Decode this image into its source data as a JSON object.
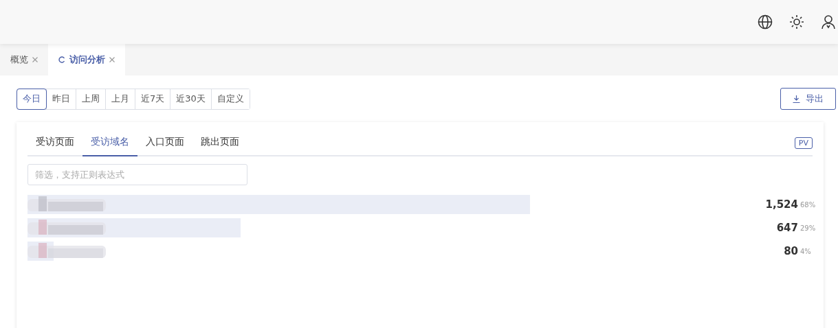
{
  "page_tabs": [
    {
      "label": "概览",
      "selected": false,
      "refresh": false
    },
    {
      "label": "访问分析",
      "selected": true,
      "refresh": true
    }
  ],
  "date_ranges": [
    {
      "label": "今日",
      "selected": true
    },
    {
      "label": "昨日",
      "selected": false
    },
    {
      "label": "上周",
      "selected": false
    },
    {
      "label": "上月",
      "selected": false
    },
    {
      "label": "近7天",
      "selected": false
    },
    {
      "label": "近30天",
      "selected": false
    },
    {
      "label": "自定义",
      "selected": false
    }
  ],
  "export_button": "导出",
  "report_tabs": [
    {
      "label": "受访页面",
      "selected": false
    },
    {
      "label": "受访域名",
      "selected": true
    },
    {
      "label": "入口页面",
      "selected": false
    },
    {
      "label": "跳出页面",
      "selected": false
    }
  ],
  "metric_badge": "PV",
  "filter": {
    "placeholder": "筛选，支持正则表达式"
  },
  "rows": [
    {
      "count": "1,524",
      "percent": "68%"
    },
    {
      "count": "647",
      "percent": "29%"
    },
    {
      "count": "80",
      "percent": "4%"
    }
  ]
}
